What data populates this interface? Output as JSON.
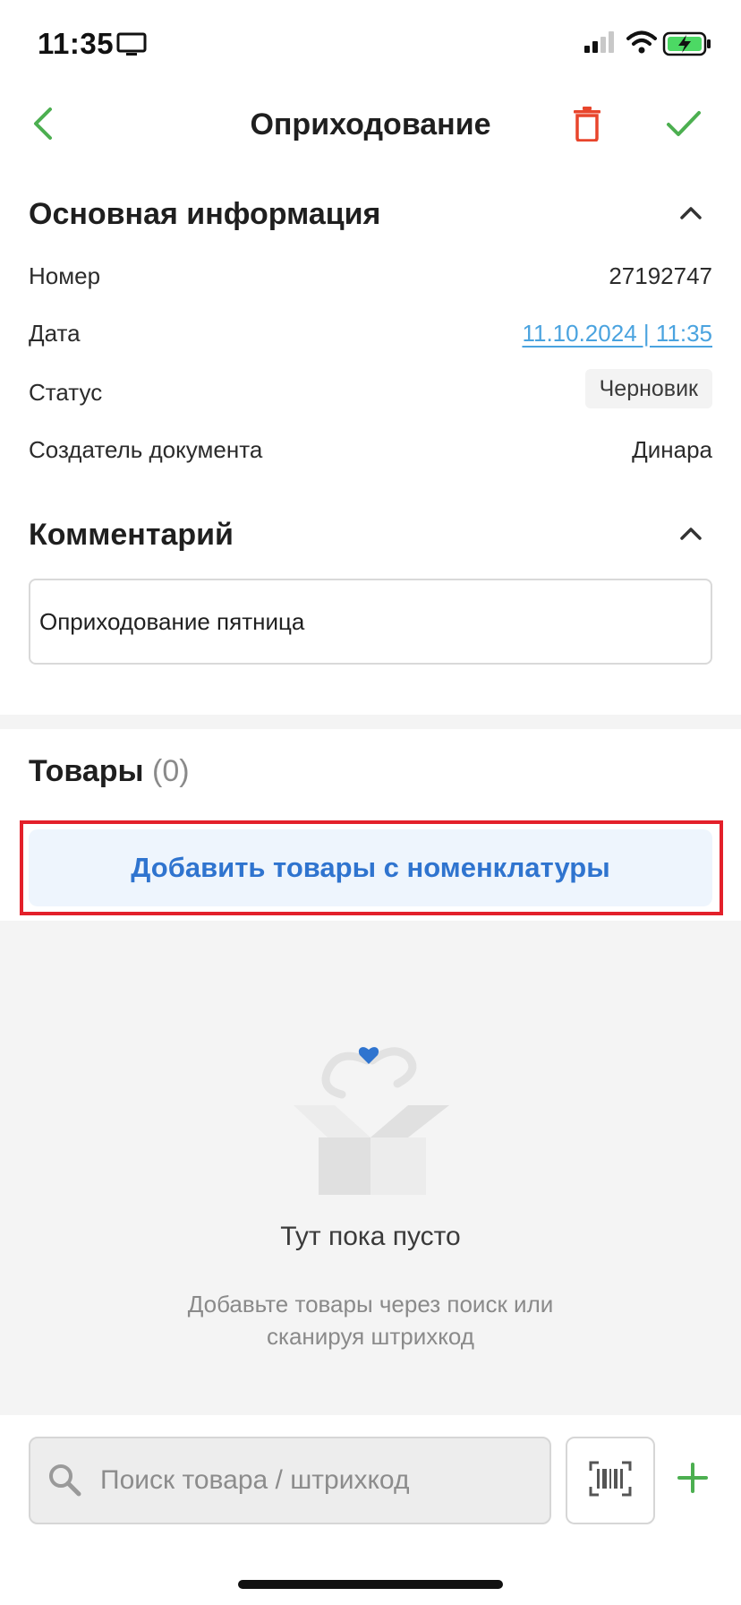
{
  "status_bar": {
    "time": "11:35",
    "icons": [
      "screen-mirror-icon",
      "signal-icon",
      "wifi-icon",
      "battery-charging-icon"
    ]
  },
  "nav": {
    "title": "Оприходование",
    "back_icon": "chevron-left-icon",
    "delete_icon": "trash-icon",
    "confirm_icon": "check-icon"
  },
  "main_info": {
    "title": "Основная информация",
    "rows": [
      {
        "label": "Номер",
        "value": "27192747"
      },
      {
        "label": "Дата",
        "value": "11.10.2024 | 11:35"
      },
      {
        "label": "Статус",
        "value": "Черновик"
      },
      {
        "label": "Создатель документа",
        "value": "Динара"
      }
    ]
  },
  "comment": {
    "title": "Комментарий",
    "value": "Оприходование пятница"
  },
  "goods": {
    "title": "Товары",
    "count": "(0)",
    "add_button": "Добавить товары с номенклатуры",
    "empty_title": "Тут пока пусто",
    "empty_line1": "Добавьте товары через поиск или",
    "empty_line2": "сканируя штрихкод"
  },
  "search": {
    "placeholder": "Поиск товара / штрихкод",
    "value": ""
  },
  "colors": {
    "accent_green": "#4caf50",
    "danger_red": "#e8452c",
    "link_blue": "#4aa3df",
    "button_blue": "#2f74cf",
    "highlight_red": "#e3202a"
  }
}
